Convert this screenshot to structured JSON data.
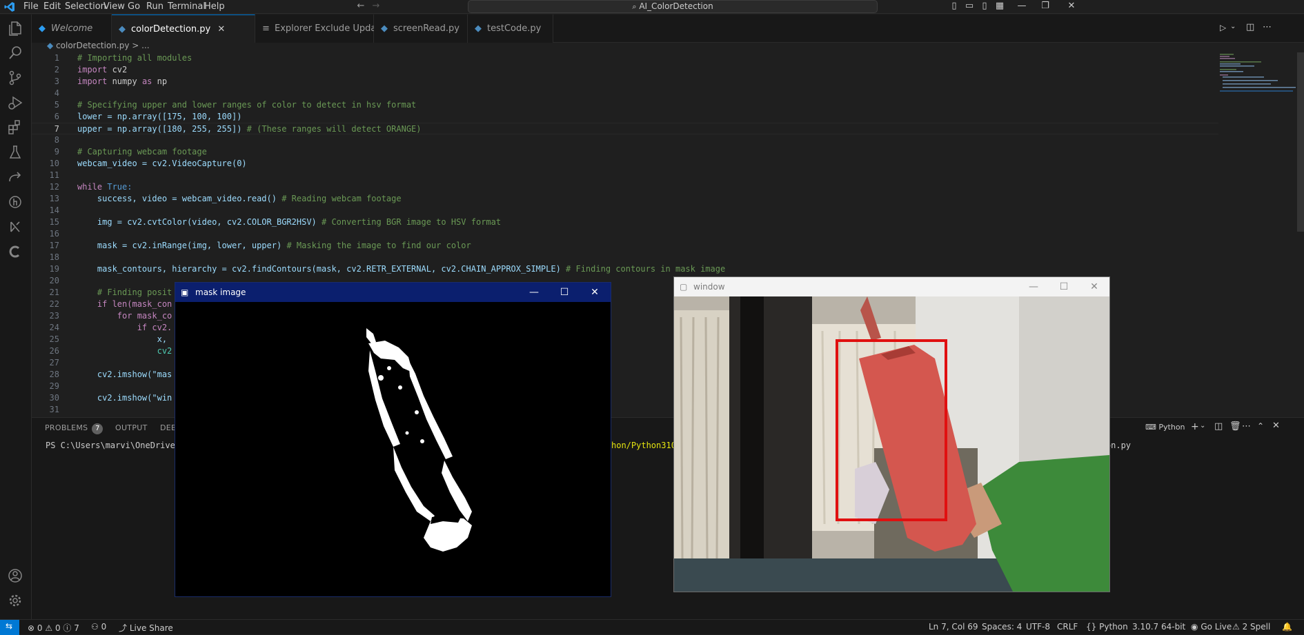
{
  "titlebar": {
    "menus": [
      "File",
      "Edit",
      "Selection",
      "View",
      "Go",
      "Run",
      "Terminal",
      "Help"
    ],
    "search_text": "AI_ColorDetection",
    "back_icon": "arrow-left-icon",
    "forward_icon": "arrow-right-icon"
  },
  "activitybar": {
    "items": [
      "explorer-icon",
      "search-icon",
      "source-control-icon",
      "run-debug-icon",
      "extensions-icon",
      "testing-icon",
      "live-share-icon",
      "git-graph-icon",
      "remote-icon",
      "copilot-icon"
    ],
    "bottom": [
      "account-icon",
      "settings-gear-icon"
    ]
  },
  "tabs": [
    {
      "label": "Welcome",
      "italic": true
    },
    {
      "label": "colorDetection.py",
      "active": true
    },
    {
      "label": "Explorer Exclude Update"
    },
    {
      "label": "screenRead.py"
    },
    {
      "label": "testCode.py"
    }
  ],
  "breadcrumb": {
    "file": "colorDetection.py",
    "sep": ">",
    "rest": "..."
  },
  "code_lines": [
    "1",
    "2",
    "3",
    "4",
    "5",
    "6",
    "7",
    "8",
    "9",
    "10",
    "11",
    "12",
    "13",
    "14",
    "15",
    "16",
    "17",
    "18",
    "19",
    "20",
    "21",
    "22",
    "23",
    "24",
    "25",
    "26",
    "27",
    "28",
    "29",
    "30",
    "31"
  ],
  "code": {
    "l1": "# Importing all modules",
    "l2a": "import",
    "l2b": " cv2",
    "l3a": "import",
    "l3b": " numpy ",
    "l3c": "as",
    "l3d": " np",
    "l5": "# Specifying upper and lower ranges of color to detect in hsv format",
    "l6": "lower = np.array([175, 100, 100])",
    "l7a": "upper = np.array([180, 255, 255])",
    "l7b": " # (These ranges will detect ORANGE)",
    "l9": "# Capturing webcam footage",
    "l10": "webcam_video = cv2.VideoCapture(0)",
    "l12a": "while",
    "l12b": " True:",
    "l13a": "    success, video = webcam_video.read()",
    "l13b": " # Reading webcam footage",
    "l15a": "    img = cv2.cvtColor(video, cv2.COLOR_BGR2HSV)",
    "l15b": " # Converting BGR image to HSV format",
    "l17a": "    mask = cv2.inRange(img, lower, upper)",
    "l17b": " # Masking the image to find our color",
    "l19a": "    mask_contours, hierarchy = cv2.findContours(mask, cv2.RETR_EXTERNAL, cv2.CHAIN_APPROX_SIMPLE)",
    "l19b": " # Finding contours in mask image",
    "l21": "    # Finding posit",
    "l22": "    if len(mask_con",
    "l23": "        for mask_co",
    "l24": "            if cv2.",
    "l25": "                x,",
    "l26": "                cv2",
    "l28": "    cv2.imshow(\"mas",
    "l30": "    cv2.imshow(\"win"
  },
  "panel": {
    "tabs": [
      "PROBLEMS",
      "OUTPUT",
      "DEBU"
    ],
    "problems_count": "7",
    "terminal_prefix": "PS C:\\Users\\marvi\\OneDrive\\",
    "terminal_mid": "hon/Python310",
    "terminal_end": "ection.py",
    "terminal_name": "Python"
  },
  "statusbar": {
    "errors": "0",
    "warnings": "0",
    "infos": "7",
    "ports": "0",
    "live_share": "Live Share",
    "position": "Ln 7, Col 69",
    "spaces": "Spaces: 4",
    "encoding": "UTF-8",
    "eol": "CRLF",
    "language": "Python",
    "interpreter": "3.10.7 64-bit",
    "go_live": "Go Live",
    "spell": "2 Spell"
  },
  "mask_window": {
    "title": "mask image"
  },
  "cam_window": {
    "title": "window"
  },
  "colors": {
    "accent": "#0078d4",
    "detect_box": "#e01010",
    "bottle": "#d4574f"
  }
}
